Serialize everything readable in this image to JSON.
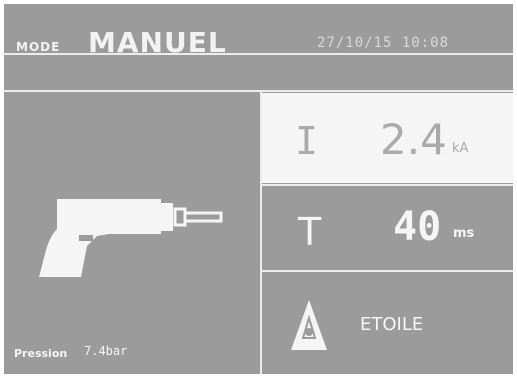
{
  "header": {
    "mode_label": "MODE",
    "mode_value": "MANUEL",
    "datetime": "27/10/15 10:08"
  },
  "current": {
    "symbol": "I",
    "value": "2.4",
    "unit": "kA"
  },
  "time": {
    "symbol": "T",
    "value": "40",
    "unit": "ms"
  },
  "electrode_mode": {
    "label": "ETOILE",
    "icon": "triangle-star-icon"
  },
  "pressure": {
    "label": "Pression",
    "value": "7.4bar"
  },
  "tool": {
    "icon": "spot-welding-gun-icon"
  },
  "colors": {
    "background": "#9b9b9b",
    "foreground": "#f2f2f2",
    "highlight_panel": "#f5f5f5"
  }
}
